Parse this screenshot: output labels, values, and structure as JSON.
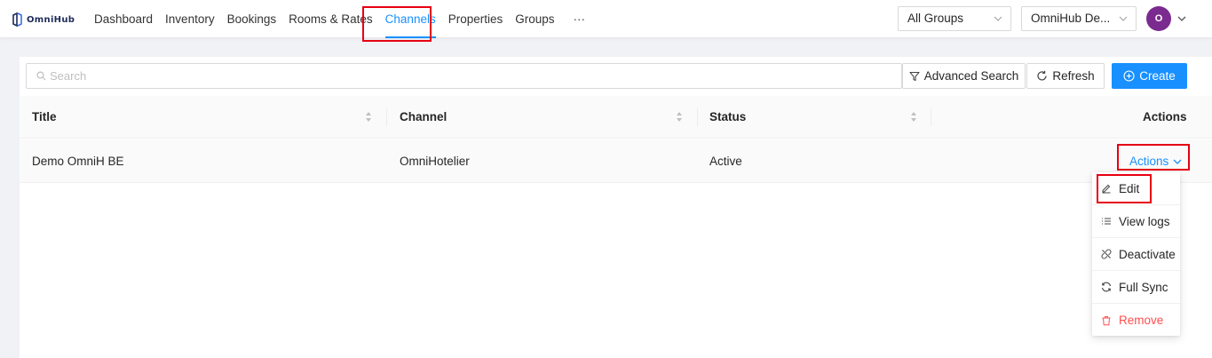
{
  "app": {
    "name": "OmniHub"
  },
  "nav": {
    "items": [
      {
        "label": "Dashboard"
      },
      {
        "label": "Inventory"
      },
      {
        "label": "Bookings"
      },
      {
        "label": "Rooms & Rates"
      },
      {
        "label": "Channels",
        "active": true
      },
      {
        "label": "Properties"
      },
      {
        "label": "Groups"
      }
    ],
    "more_label": "···"
  },
  "header": {
    "group_select": "All Groups",
    "property_select": "OmniHub De...",
    "avatar_initial": "O"
  },
  "toolbar": {
    "search_placeholder": "Search",
    "search_value": "",
    "advanced_search": "Advanced Search",
    "refresh": "Refresh",
    "create": "Create"
  },
  "table": {
    "columns": [
      "Title",
      "Channel",
      "Status",
      "Actions"
    ],
    "rows": [
      {
        "title": "Demo OmniH BE",
        "channel": "OmniHotelier",
        "status": "Active",
        "actions": "Actions"
      }
    ]
  },
  "dropdown": {
    "items": [
      {
        "label": "Edit",
        "icon": "edit-icon"
      },
      {
        "label": "View logs",
        "icon": "list-icon"
      },
      {
        "label": "Deactivate",
        "icon": "disconnect-icon"
      },
      {
        "label": "Full Sync",
        "icon": "sync-icon"
      },
      {
        "label": "Remove",
        "icon": "trash-icon"
      }
    ]
  },
  "colors": {
    "primary": "#1890ff",
    "danger": "#ff4d4f",
    "highlight": "#e60012",
    "avatar": "#7b2a8f"
  }
}
